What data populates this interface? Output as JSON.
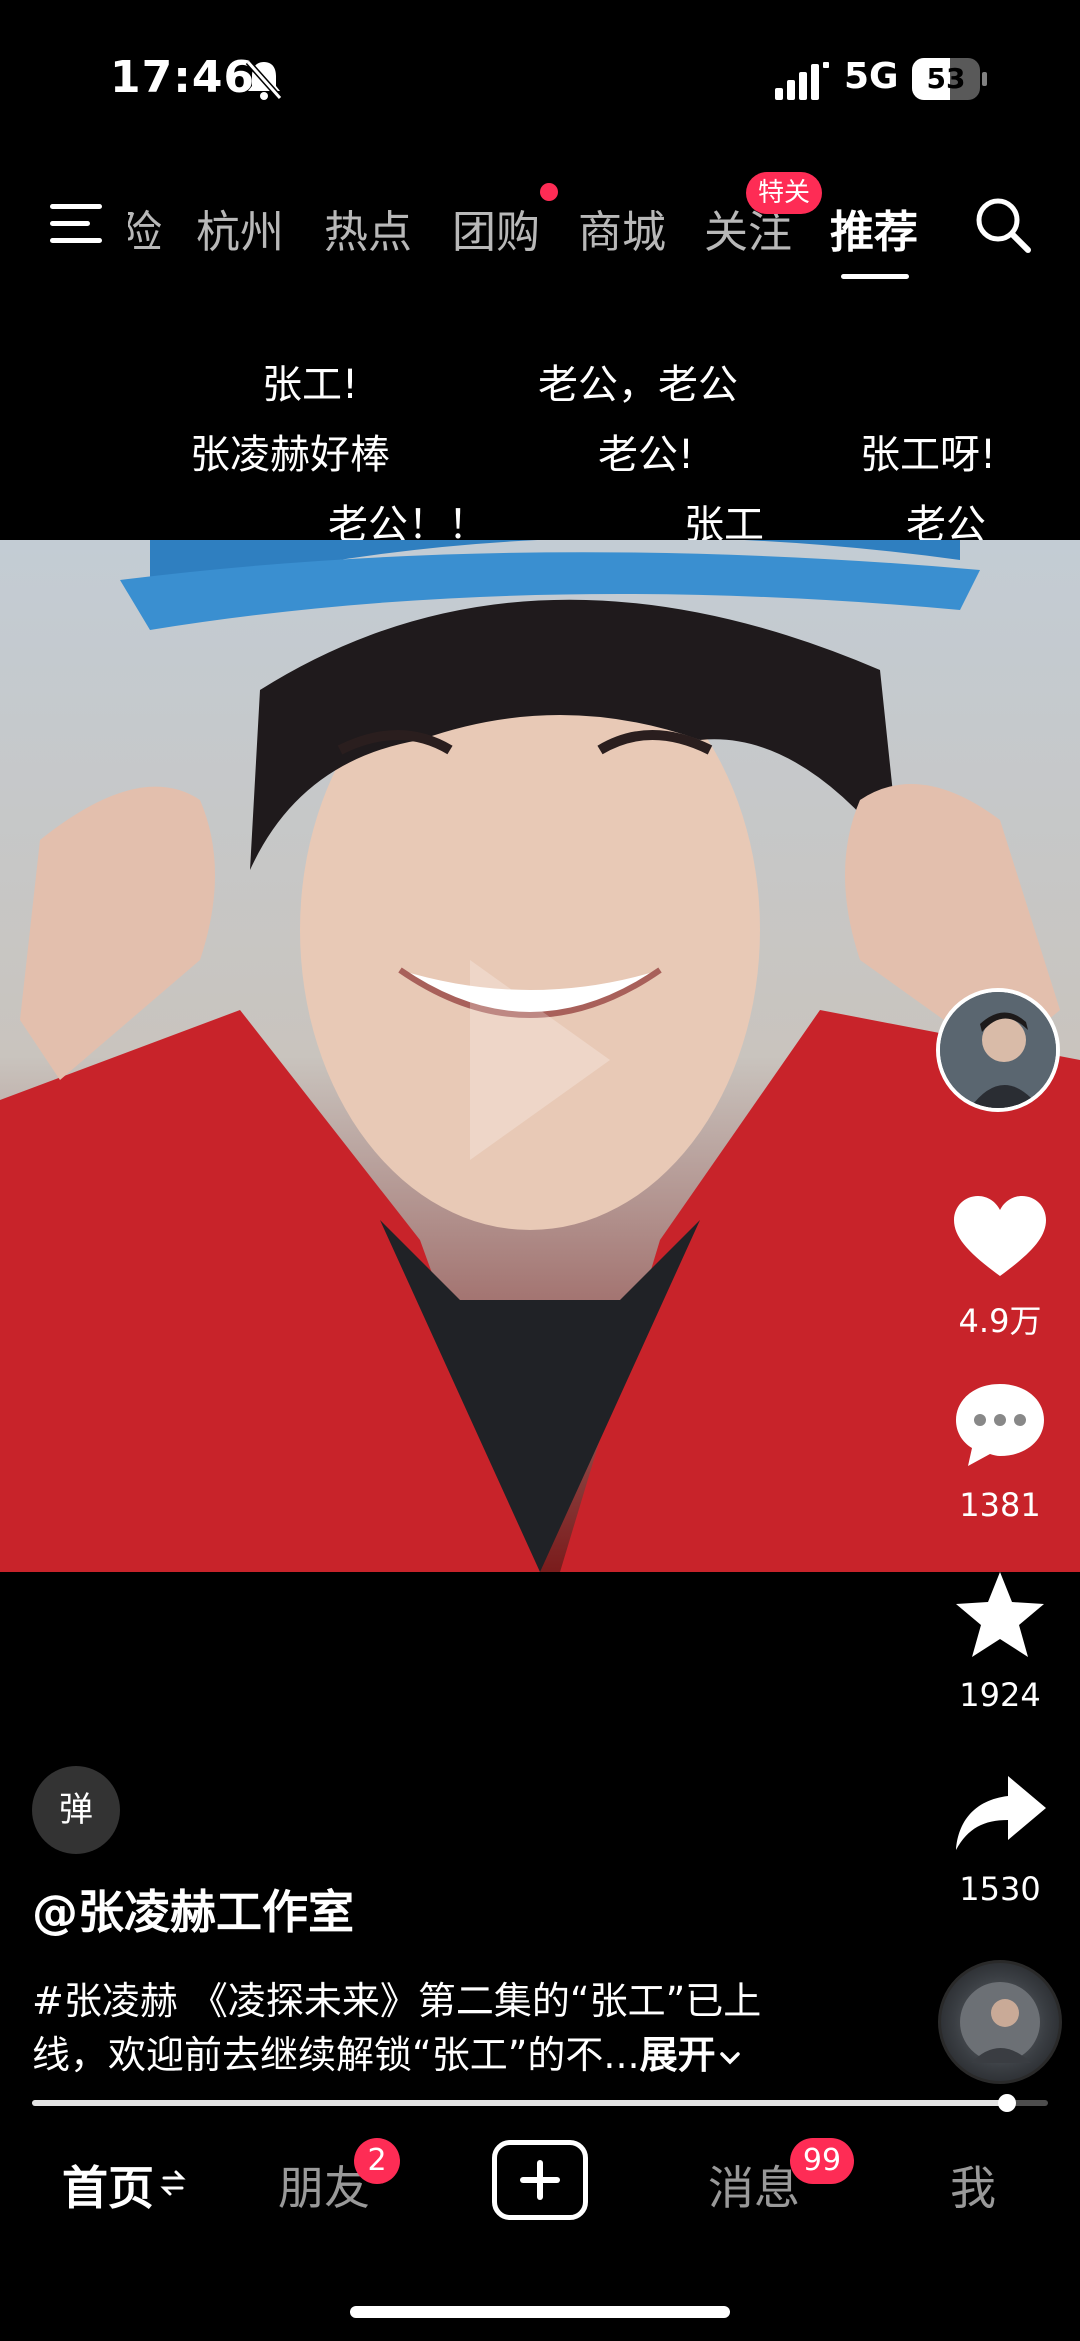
{
  "status_bar": {
    "time": "17:46",
    "network": "5G",
    "battery": "53",
    "icons": [
      "bell-off-icon",
      "signal-icon",
      "battery-icon"
    ]
  },
  "top_nav": {
    "partial_tab": "险",
    "tabs": [
      {
        "label": "杭州"
      },
      {
        "label": "热点"
      },
      {
        "label": "团购"
      },
      {
        "label": "商城"
      },
      {
        "label": "关注"
      },
      {
        "label": "推荐"
      }
    ],
    "active_tab": "推荐",
    "follow_badge": "特关",
    "icons": [
      "menu-icon",
      "search-icon"
    ]
  },
  "danmaku": [
    {
      "text": "张工!"
    },
    {
      "text": "老公，老公"
    },
    {
      "text": "张凌赫好棒"
    },
    {
      "text": "老公!"
    },
    {
      "text": "张工呀!"
    },
    {
      "text": "老公！！"
    },
    {
      "text": "张工"
    },
    {
      "text": "老公"
    }
  ],
  "right_rail": {
    "like_count": "4.9万",
    "comment_count": "1381",
    "favorite_count": "1924",
    "share_count": "1530",
    "icons": [
      "heart-icon",
      "comment-icon",
      "star-icon",
      "share-icon"
    ]
  },
  "video_info": {
    "danmu_toggle": "弹",
    "author": "@张凌赫工作室",
    "description_line1": "#张凌赫 《凌探未来》第二集的“张工”已上",
    "description_line2": "线，欢迎前去继续解锁“张工”的不...",
    "expand_label": "展开",
    "progress": 0.96
  },
  "bottom_tabs": {
    "home": "首页",
    "friends": "朋友",
    "friends_badge": "2",
    "messages": "消息",
    "messages_badge": "99",
    "me": "我"
  },
  "colors": {
    "accent": "#fe2c55",
    "background": "#000000",
    "text": "#ffffff"
  }
}
